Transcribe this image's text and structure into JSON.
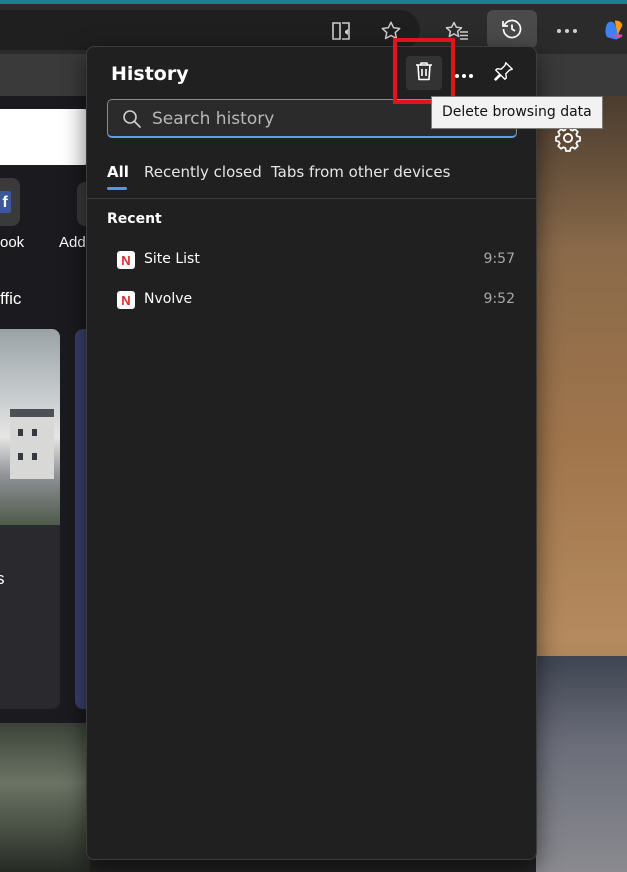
{
  "flyout": {
    "title": "History",
    "actions": {
      "delete_icon": "trash-icon",
      "more_icon": "more-horizontal-icon",
      "pin_icon": "pin-icon"
    },
    "search": {
      "placeholder": "Search history",
      "value": ""
    },
    "tabs": [
      {
        "label": "All",
        "active": true
      },
      {
        "label": "Recently closed",
        "active": false
      },
      {
        "label": "Tabs from other devices",
        "active": false
      }
    ],
    "section_title": "Recent",
    "items": [
      {
        "favicon_letter": "N",
        "title": "Site List",
        "time": "9:57"
      },
      {
        "favicon_letter": "N",
        "title": "Nvolve",
        "time": "9:52"
      }
    ]
  },
  "tooltip": {
    "text": "Delete browsing data"
  },
  "background": {
    "tile_labels": [
      "ook",
      "Add"
    ],
    "traffic_text": "ffic",
    "card_text": "s"
  },
  "colors": {
    "accent": "#4c9bf0",
    "highlight": "#e0141b",
    "flyout_bg": "#202020",
    "favicon_letter": "#e22b2b"
  }
}
